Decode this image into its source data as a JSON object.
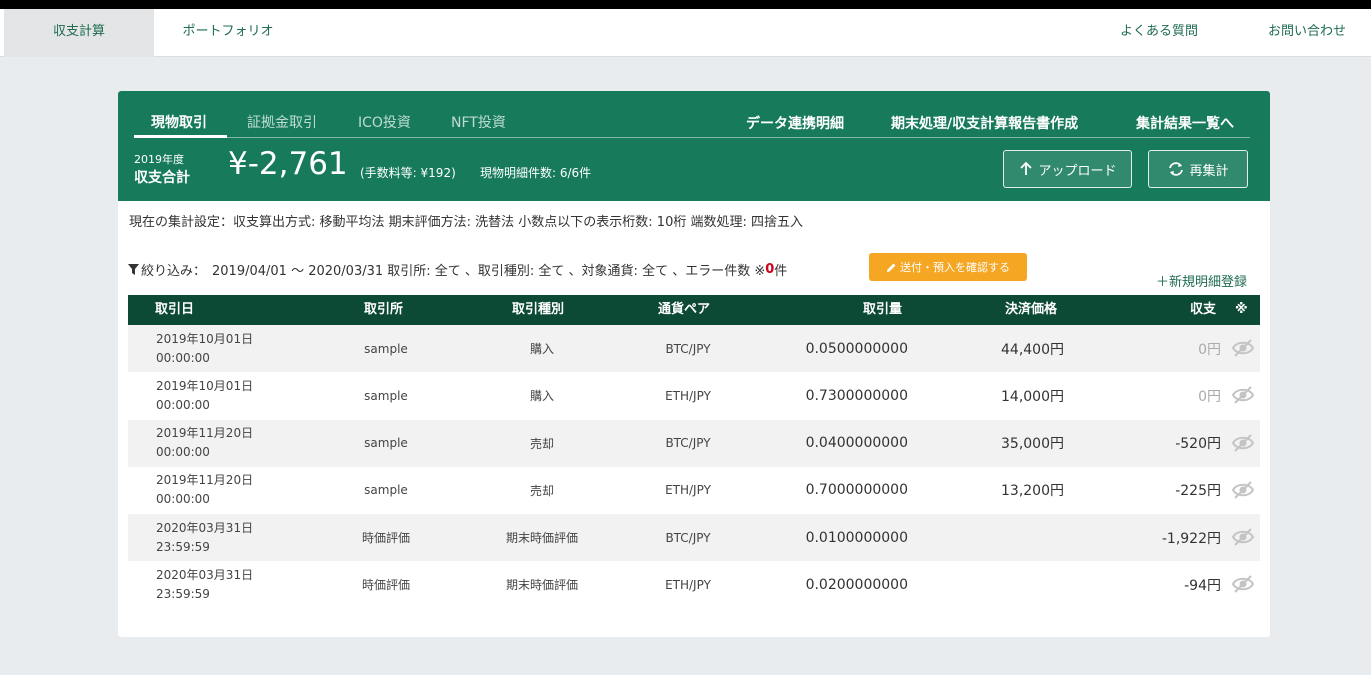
{
  "nav": {
    "items": [
      {
        "label": "収支計算",
        "active": true
      },
      {
        "label": "ポートフォリオ",
        "active": false
      }
    ],
    "right": [
      {
        "label": "よくある質問"
      },
      {
        "label": "お問い合わせ"
      }
    ]
  },
  "header": {
    "tabs": [
      {
        "label": "現物取引",
        "active": true
      },
      {
        "label": "証拠金取引",
        "active": false
      },
      {
        "label": "ICO投資",
        "active": false
      },
      {
        "label": "NFT投資",
        "active": false
      }
    ],
    "links": [
      "データ連携明細",
      "期末処理/収支計算報告書作成",
      "集計結果一覧へ"
    ],
    "year": "2019年度",
    "total_label": "収支合計",
    "total_amount": "¥-2,761",
    "fee": "(手数料等: ¥192)",
    "count": "現物明細件数: 6/6件",
    "upload_label": "アップロード",
    "recalc_label": "再集計"
  },
  "settings": "現在の集計設定：収支算出方式: 移動平均法  期末評価方法: 洗替法  小数点以下の表示桁数: 10桁  端数処理: 四捨五入",
  "filter": {
    "prefix": "絞り込み：",
    "text": "2019/04/01 〜 2020/03/31 取引所: 全て 、取引種別: 全て 、対象通貨: 全て 、エラー件数 ※",
    "error_count": "0",
    "suffix": "件",
    "confirm_label": "送付・預入を確認する",
    "new_label": "＋新規明細登録"
  },
  "table": {
    "headers": [
      "取引日",
      "取引所",
      "取引種別",
      "通貨ペア",
      "取引量",
      "決済価格",
      "収支",
      "※"
    ],
    "rows": [
      {
        "date": "2019年10月01日",
        "time": "00:00:00",
        "exchange": "sample",
        "type": "購入",
        "pair": "BTC/JPY",
        "qty": "0.0500000000",
        "price": "44,400円",
        "pl": "0円"
      },
      {
        "date": "2019年10月01日",
        "time": "00:00:00",
        "exchange": "sample",
        "type": "購入",
        "pair": "ETH/JPY",
        "qty": "0.7300000000",
        "price": "14,000円",
        "pl": "0円"
      },
      {
        "date": "2019年11月20日",
        "time": "00:00:00",
        "exchange": "sample",
        "type": "売却",
        "pair": "BTC/JPY",
        "qty": "0.0400000000",
        "price": "35,000円",
        "pl": "-520円"
      },
      {
        "date": "2019年11月20日",
        "time": "00:00:00",
        "exchange": "sample",
        "type": "売却",
        "pair": "ETH/JPY",
        "qty": "0.7000000000",
        "price": "13,200円",
        "pl": "-225円"
      },
      {
        "date": "2020年03月31日",
        "time": "23:59:59",
        "exchange": "時価評価",
        "type": "期末時価評価",
        "pair": "BTC/JPY",
        "qty": "0.0100000000",
        "price": "",
        "pl": "-1,922円"
      },
      {
        "date": "2020年03月31日",
        "time": "23:59:59",
        "exchange": "時価評価",
        "type": "期末時価評価",
        "pair": "ETH/JPY",
        "qty": "0.0200000000",
        "price": "",
        "pl": "-94円"
      }
    ]
  },
  "colors": {
    "primary": "#167a5b",
    "table_header": "#0c4a36",
    "orange": "#f5a623",
    "error": "#d0021b",
    "link": "#1e6b4f"
  }
}
